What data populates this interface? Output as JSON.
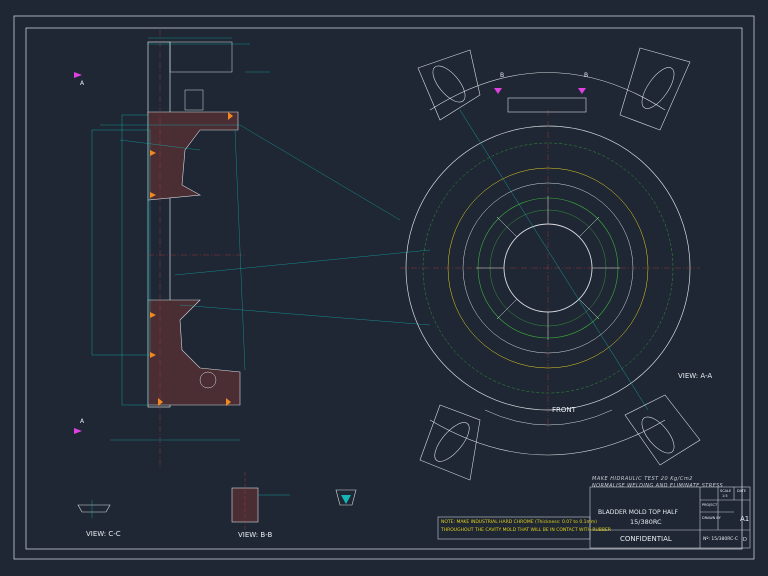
{
  "views": {
    "view_aa": "VIEW: A-A",
    "view_cc": "VIEW: C-C",
    "view_bb": "VIEW: B-B",
    "front": "FRONT"
  },
  "section_markers": {
    "a_top": "A",
    "a_bottom": "A",
    "b_left": "B",
    "b_right": "B"
  },
  "notes": {
    "hydraulic_test": "MAKE HIDRAULIC TEST   20 Kg/Cm2",
    "normalise": "NORMALISE WELDING AND ELIMINATE STRESS",
    "chrome_line1": "NOTE: MAKE INDUSTRIAL HARD CHROME (Thickness: 0.07 to 0.1mm)",
    "chrome_line2": "THROUGHOUT THE CAVITY MOLD THAT WILL BE IN CONTACT WITH RUBBER"
  },
  "title_block": {
    "title_line1": "BLADDER MOLD TOP HALF",
    "title_line2": "15/380RC",
    "confidential": "CONFIDENTIAL",
    "sheet_size": "A1",
    "drawing_number": "Nº: 15/380RC-C",
    "revision": "D",
    "scale_label": "SCALE",
    "scale_value": "1:5",
    "date_label": "DATE",
    "project_label": "PROJECT",
    "drawn_by_label": "DRAWN BY"
  },
  "colors": {
    "background": "#1e2733",
    "border": "#c9ced6",
    "outline": "#d6dbe2",
    "section_fill": "#4a2e33",
    "dimension": "#16b5b5",
    "centerline": "#b43a3a",
    "hidden_green": "#3fae3f",
    "yellow": "#e6d21e",
    "marker_magenta": "#e040e0",
    "weld_orange": "#f08a1e",
    "title_text": "#e8ecf2"
  }
}
